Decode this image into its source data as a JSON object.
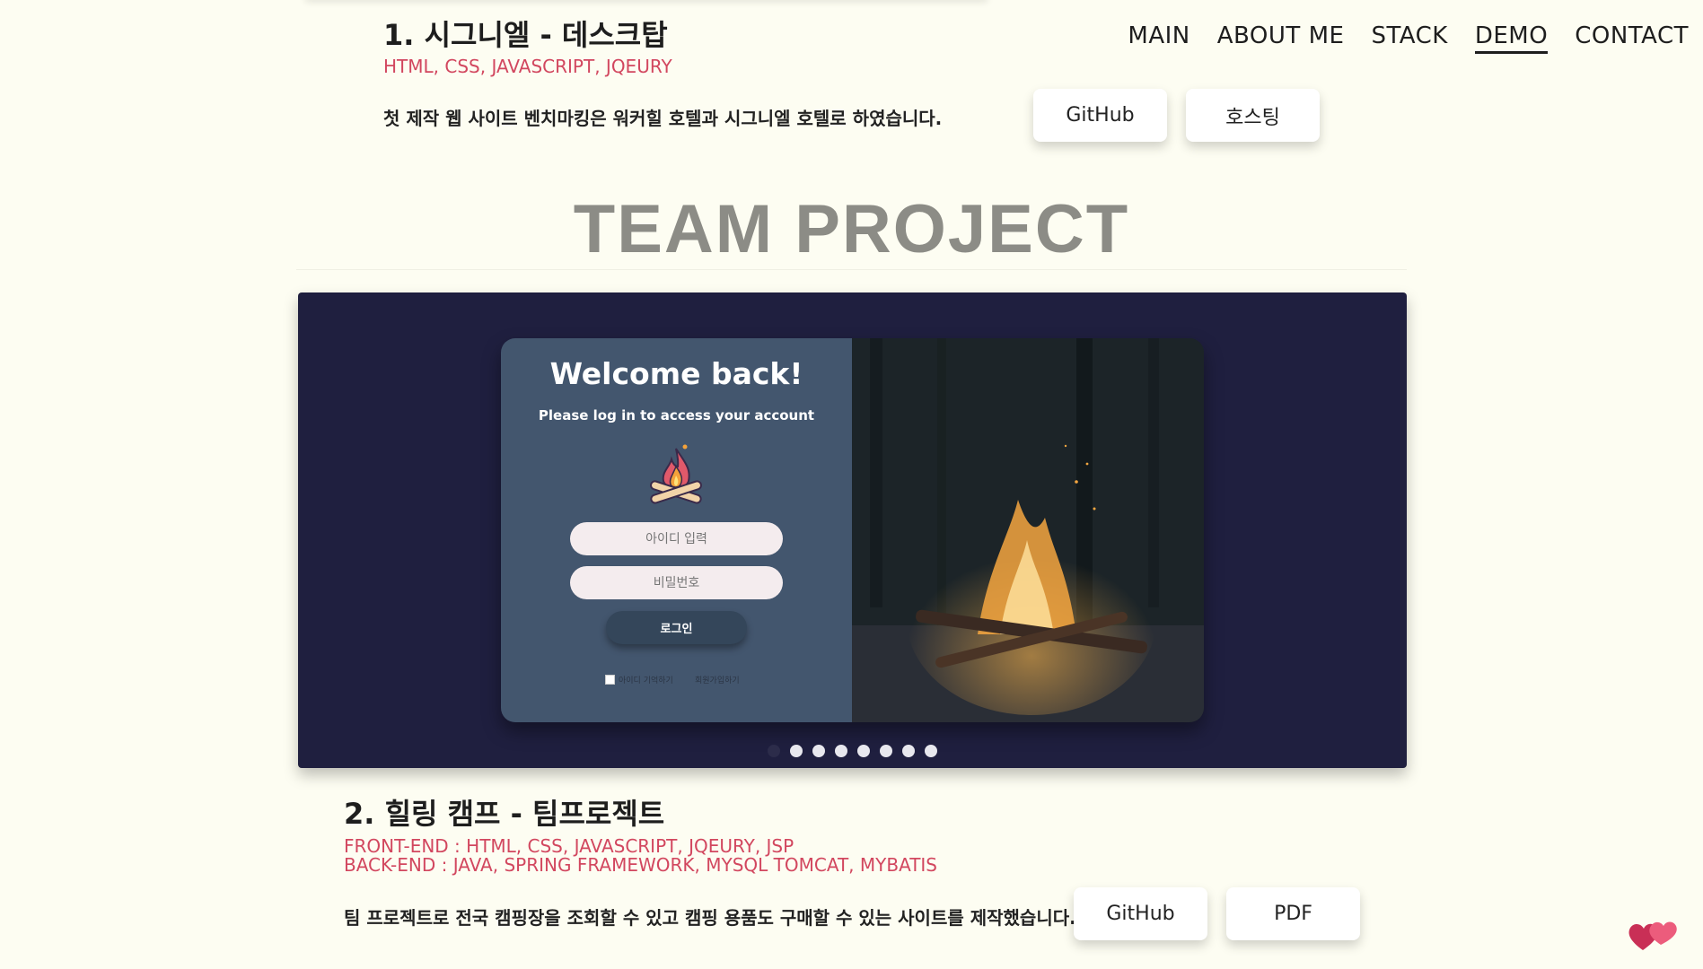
{
  "nav": {
    "items": [
      {
        "label": "MAIN",
        "active": false
      },
      {
        "label": "ABOUT ME",
        "active": false
      },
      {
        "label": "STACK",
        "active": false
      },
      {
        "label": "DEMO",
        "active": true
      },
      {
        "label": "CONTACT",
        "active": false
      }
    ]
  },
  "project1": {
    "title": "1. 시그니엘 - 데스크탑",
    "stack": "HTML, CSS, JAVASCRIPT, JQEURY",
    "description": "첫 제작 웹 사이트 벤치마킹은 워커힐 호텔과 시그니엘 호텔로 하였습니다.",
    "github_label": "GitHub",
    "hosting_label": "호스팅"
  },
  "section": {
    "title": "TEAM PROJECT"
  },
  "slider": {
    "slide": {
      "welcome": "Welcome back!",
      "subtitle": "Please log in to access your account",
      "id_placeholder": "아이디 입력",
      "pw_placeholder": "비밀번호",
      "login_label": "로그인",
      "remember_label": "아이디 기억하기",
      "signup_label": "회원가입하기",
      "icon": "campfire-icon"
    },
    "dots_count": 8,
    "active_dot": 0
  },
  "project2": {
    "title": "2. 힐링 캠프 - 팀프로젝트",
    "frontend": "FRONT-END : HTML, CSS, JAVASCRIPT, JQEURY, JSP",
    "backend": "BACK-END : JAVA, SPRING FRAMEWORK, MYSQL TOMCAT, MYBATIS",
    "description": "팀 프로젝트로 전국 캠핑장을 조회할 수 있고 캠핑 용품도 구매할 수 있는 사이트를 제작했습니다.",
    "github_label": "GitHub",
    "pdf_label": "PDF"
  },
  "colors": {
    "background": "#fdfdf2",
    "accent": "#d2475f",
    "slider_bg": "#1f1f3f",
    "card_left": "#43566e"
  }
}
